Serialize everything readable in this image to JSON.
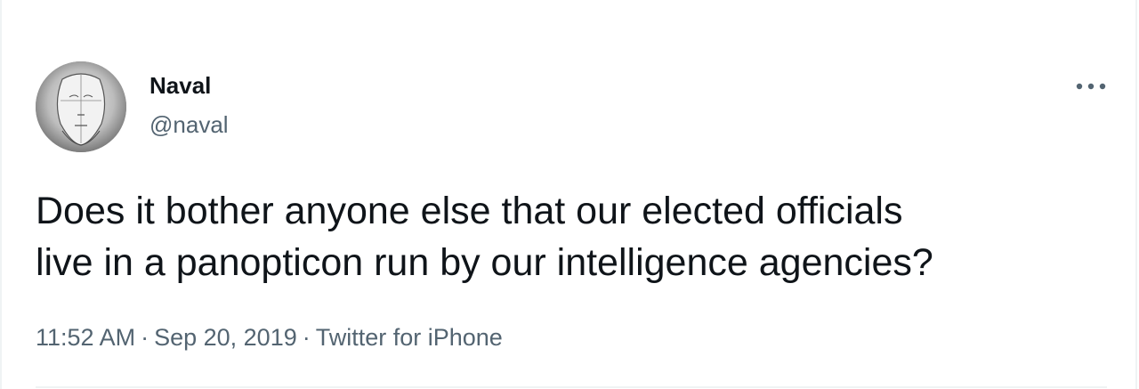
{
  "tweet": {
    "author_name": "Naval",
    "author_handle": "@naval",
    "text_line_1": "Does it bother anyone else that our elected officials",
    "text_line_2": "live in a panopticon run by our intelligence agencies?",
    "time": "11:52 AM",
    "separator": "·",
    "date": "Sep 20, 2019",
    "source": "Twitter for iPhone"
  },
  "icons": {
    "more": "more-horizontal-icon",
    "avatar": "avatar-sketch-face"
  },
  "colors": {
    "text_primary": "#0f1419",
    "text_secondary": "#536471",
    "border": "#eff3f4"
  }
}
